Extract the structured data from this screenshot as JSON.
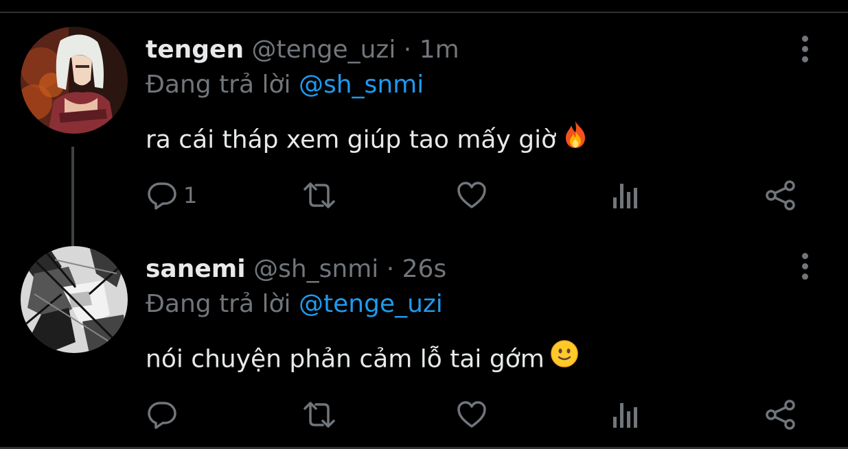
{
  "tweets": [
    {
      "display_name": "tengen",
      "handle": "@tenge_uzi",
      "separator": "·",
      "time": "1m",
      "reply_prefix": "Đang trả lời",
      "reply_to": "@sh_snmi",
      "text": "ra cái tháp xem giúp tao mấy giờ",
      "emoji": "fire-emoji",
      "reply_count": "1",
      "avatar_icon": "avatar-tengen"
    },
    {
      "display_name": "sanemi",
      "handle": "@sh_snmi",
      "separator": "·",
      "time": "26s",
      "reply_prefix": "Đang trả lời",
      "reply_to": "@tenge_uzi",
      "text": "nói chuyện phản cảm lỗ tai gớm",
      "emoji": "slightly-smiling-face-emoji",
      "reply_count": "",
      "avatar_icon": "avatar-sanemi"
    }
  ],
  "colors": {
    "background": "#000000",
    "primary_text": "#e7e9ea",
    "secondary_text": "#71767b",
    "accent": "#1d9bf0",
    "divider": "#2f3336"
  }
}
